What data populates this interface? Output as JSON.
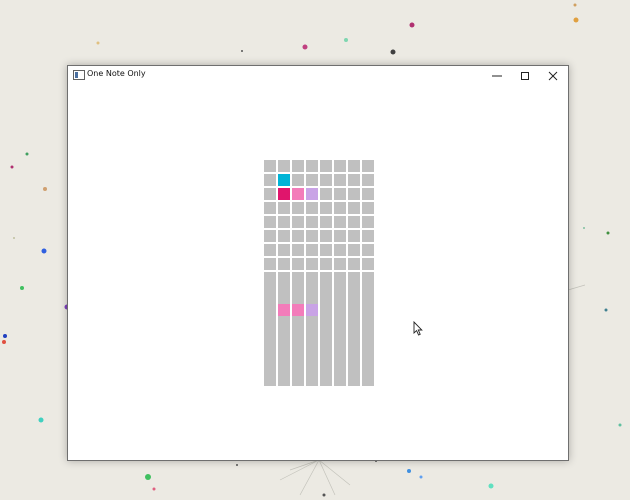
{
  "window": {
    "title": "One Note Only",
    "controls": [
      {
        "name": "minimize",
        "icon": "minimize-icon"
      },
      {
        "name": "maximize",
        "icon": "maximize-icon"
      },
      {
        "name": "close",
        "icon": "close-icon"
      }
    ]
  },
  "colors": {
    "empty": "#c0c0c0",
    "cyan": "#00b4d6",
    "crimson": "#e0156c",
    "pink": "#f37cba",
    "lavender": "#c9a3e6",
    "desktop": "#eceae3"
  },
  "grids": [
    {
      "name": "top-grid",
      "columns": 8,
      "rows": 16,
      "cells": [
        {
          "row": 1,
          "col": 1,
          "color": "cyan"
        },
        {
          "row": 2,
          "col": 1,
          "color": "crimson"
        },
        {
          "row": 2,
          "col": 2,
          "color": "pink"
        },
        {
          "row": 2,
          "col": 3,
          "color": "lavender"
        }
      ]
    },
    {
      "name": "bottom-grid",
      "columns": 8,
      "rows": 8,
      "cells": [
        {
          "row": 2,
          "col": 1,
          "color": "pink"
        },
        {
          "row": 2,
          "col": 2,
          "color": "pink"
        },
        {
          "row": 2,
          "col": 3,
          "color": "lavender"
        }
      ]
    }
  ]
}
